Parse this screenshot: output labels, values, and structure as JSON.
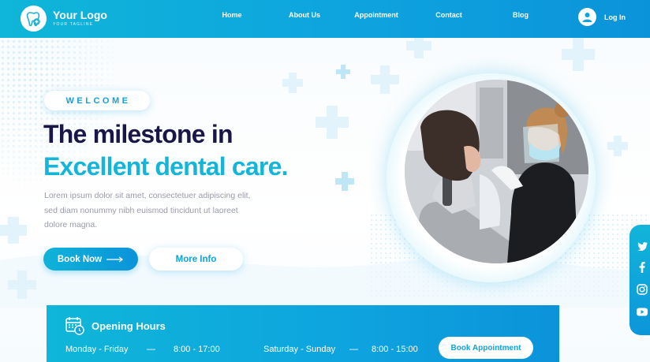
{
  "header": {
    "logo_name": "Your Logo",
    "logo_tagline": "YOUR TAGLINE",
    "nav": [
      {
        "label": "Home"
      },
      {
        "label": "About Us"
      },
      {
        "label": "Appointment"
      },
      {
        "label": "Contact"
      },
      {
        "label": "Blog"
      }
    ],
    "login_label": "Log In"
  },
  "hero": {
    "welcome": "WELCOME",
    "headline_line1": "The milestone in",
    "headline_line2": "Excellent dental care.",
    "description": "Lorem ipsum dolor sit amet, consectetuer adipiscing elit, sed diam nonummy nibh euismod tincidunt ut laoreet dolore magna.",
    "primary_button": "Book Now",
    "secondary_button": "More Info"
  },
  "opening_hours": {
    "title": "Opening Hours",
    "weekday_label": "Monday - Friday",
    "weekday_sep": "—",
    "weekday_time": "8:00 - 17:00",
    "weekend_label": "Saturday - Sunday",
    "weekend_sep": "—",
    "weekend_time": "8:00 - 15:00",
    "button": "Book Appointment"
  },
  "social": [
    "twitter-icon",
    "facebook-icon",
    "instagram-icon",
    "youtube-icon"
  ],
  "colors": {
    "primary": "#0ea3df",
    "accent": "#13b6d8",
    "heading": "#1a1748",
    "text_muted": "#9a9aac"
  }
}
